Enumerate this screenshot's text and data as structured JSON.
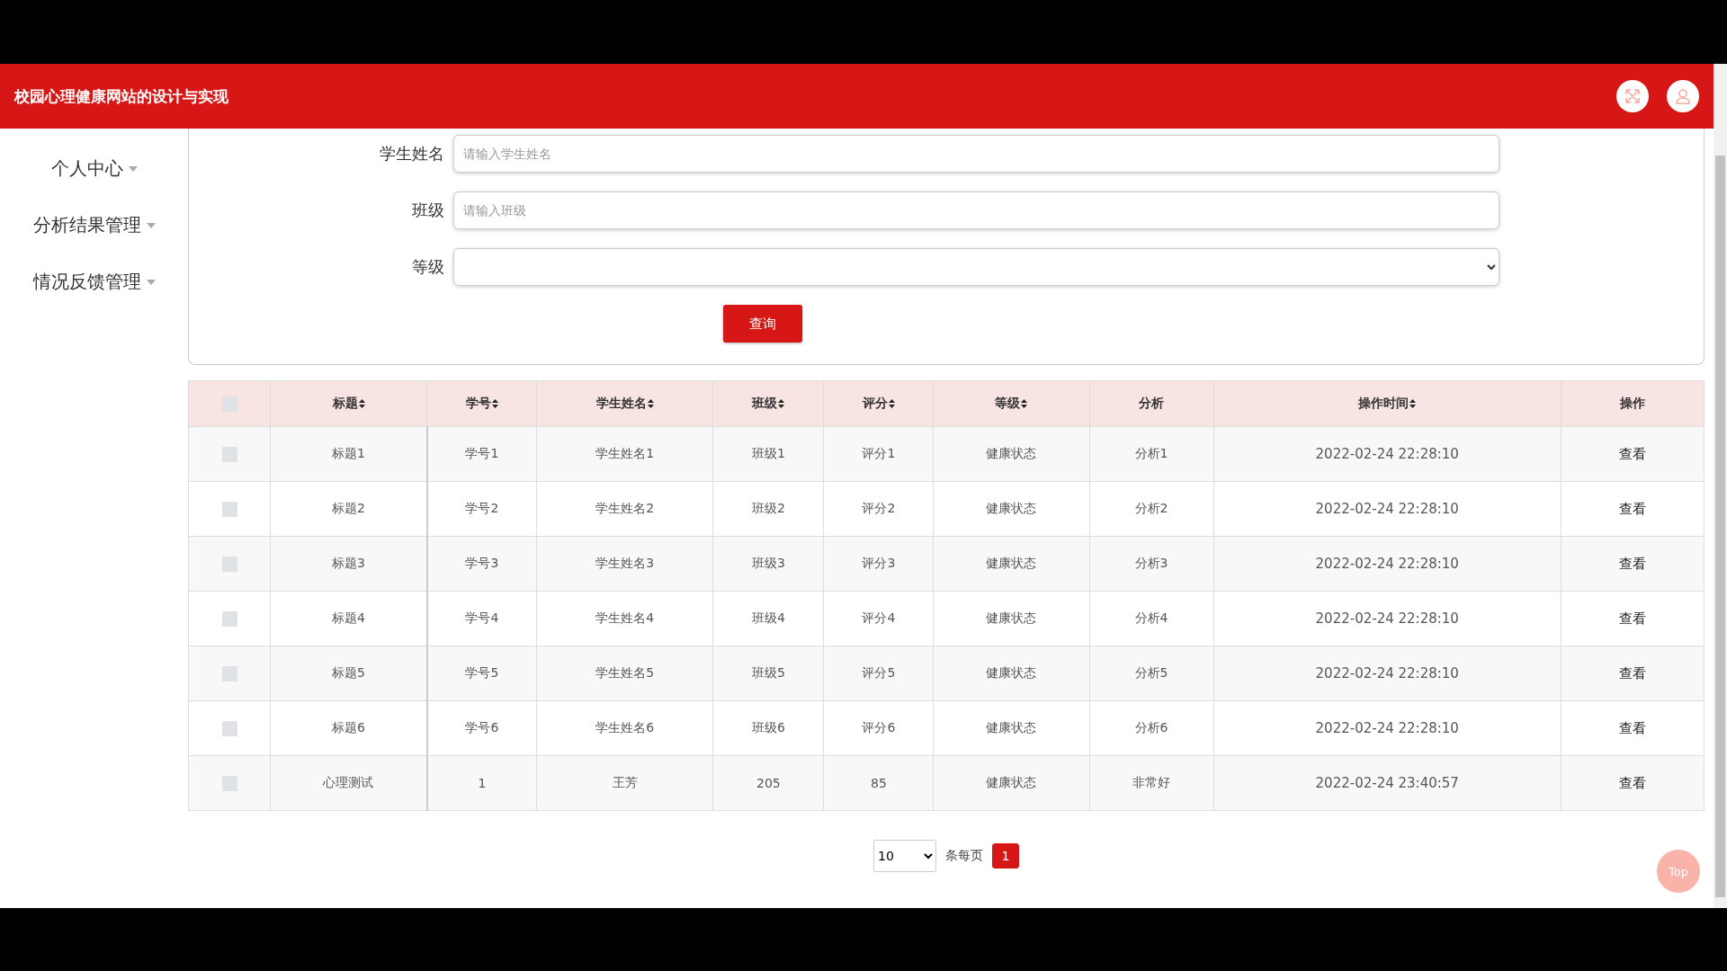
{
  "header": {
    "title": "校园心理健康网站的设计与实现"
  },
  "sidebar": {
    "items": [
      {
        "label": "个人中心",
        "expanded": false
      },
      {
        "label": "分析结果管理",
        "expanded": false
      },
      {
        "label": "情况反馈管理",
        "expanded": false
      }
    ]
  },
  "search_form": {
    "fields": [
      {
        "kind": "text",
        "label": "学生姓名",
        "placeholder": "请输入学生姓名"
      },
      {
        "kind": "text",
        "label": "班级",
        "placeholder": "请输入班级"
      },
      {
        "kind": "select",
        "label": "等级"
      }
    ],
    "button": "查询"
  },
  "table": {
    "columns": [
      {
        "label": "标题",
        "sortable": true
      },
      {
        "label": "学号",
        "sortable": true
      },
      {
        "label": "学生姓名",
        "sortable": true
      },
      {
        "label": "班级",
        "sortable": true
      },
      {
        "label": "评分",
        "sortable": true
      },
      {
        "label": "等级",
        "sortable": true
      },
      {
        "label": "分析",
        "sortable": false
      },
      {
        "label": "操作时间",
        "sortable": true
      },
      {
        "label": "操作",
        "sortable": false
      }
    ],
    "select_all": {
      "checked": false
    },
    "rows": [
      {
        "checked": false,
        "cells": [
          "标题1",
          "学号1",
          "学生姓名1",
          "班级1",
          "评分1",
          "健康状态",
          "分析1",
          "2022-02-24 22:28:10"
        ],
        "action": "查看"
      },
      {
        "checked": false,
        "cells": [
          "标题2",
          "学号2",
          "学生姓名2",
          "班级2",
          "评分2",
          "健康状态",
          "分析2",
          "2022-02-24 22:28:10"
        ],
        "action": "查看"
      },
      {
        "checked": false,
        "cells": [
          "标题3",
          "学号3",
          "学生姓名3",
          "班级3",
          "评分3",
          "健康状态",
          "分析3",
          "2022-02-24 22:28:10"
        ],
        "action": "查看"
      },
      {
        "checked": false,
        "cells": [
          "标题4",
          "学号4",
          "学生姓名4",
          "班级4",
          "评分4",
          "健康状态",
          "分析4",
          "2022-02-24 22:28:10"
        ],
        "action": "查看"
      },
      {
        "checked": false,
        "cells": [
          "标题5",
          "学号5",
          "学生姓名5",
          "班级5",
          "评分5",
          "健康状态",
          "分析5",
          "2022-02-24 22:28:10"
        ],
        "action": "查看"
      },
      {
        "checked": false,
        "cells": [
          "标题6",
          "学号6",
          "学生姓名6",
          "班级6",
          "评分6",
          "健康状态",
          "分析6",
          "2022-02-24 22:28:10"
        ],
        "action": "查看"
      },
      {
        "checked": false,
        "cells": [
          "心理测试",
          "1",
          "王芳",
          "205",
          "85",
          "健康状态",
          "非常好",
          "2022-02-24 23:40:57"
        ],
        "action": "查看"
      }
    ]
  },
  "pagination": {
    "page_size": "10",
    "page_size_label": "条每页",
    "pages": [
      {
        "label": "1",
        "selected": true
      }
    ]
  },
  "back_to_top": "Top"
}
